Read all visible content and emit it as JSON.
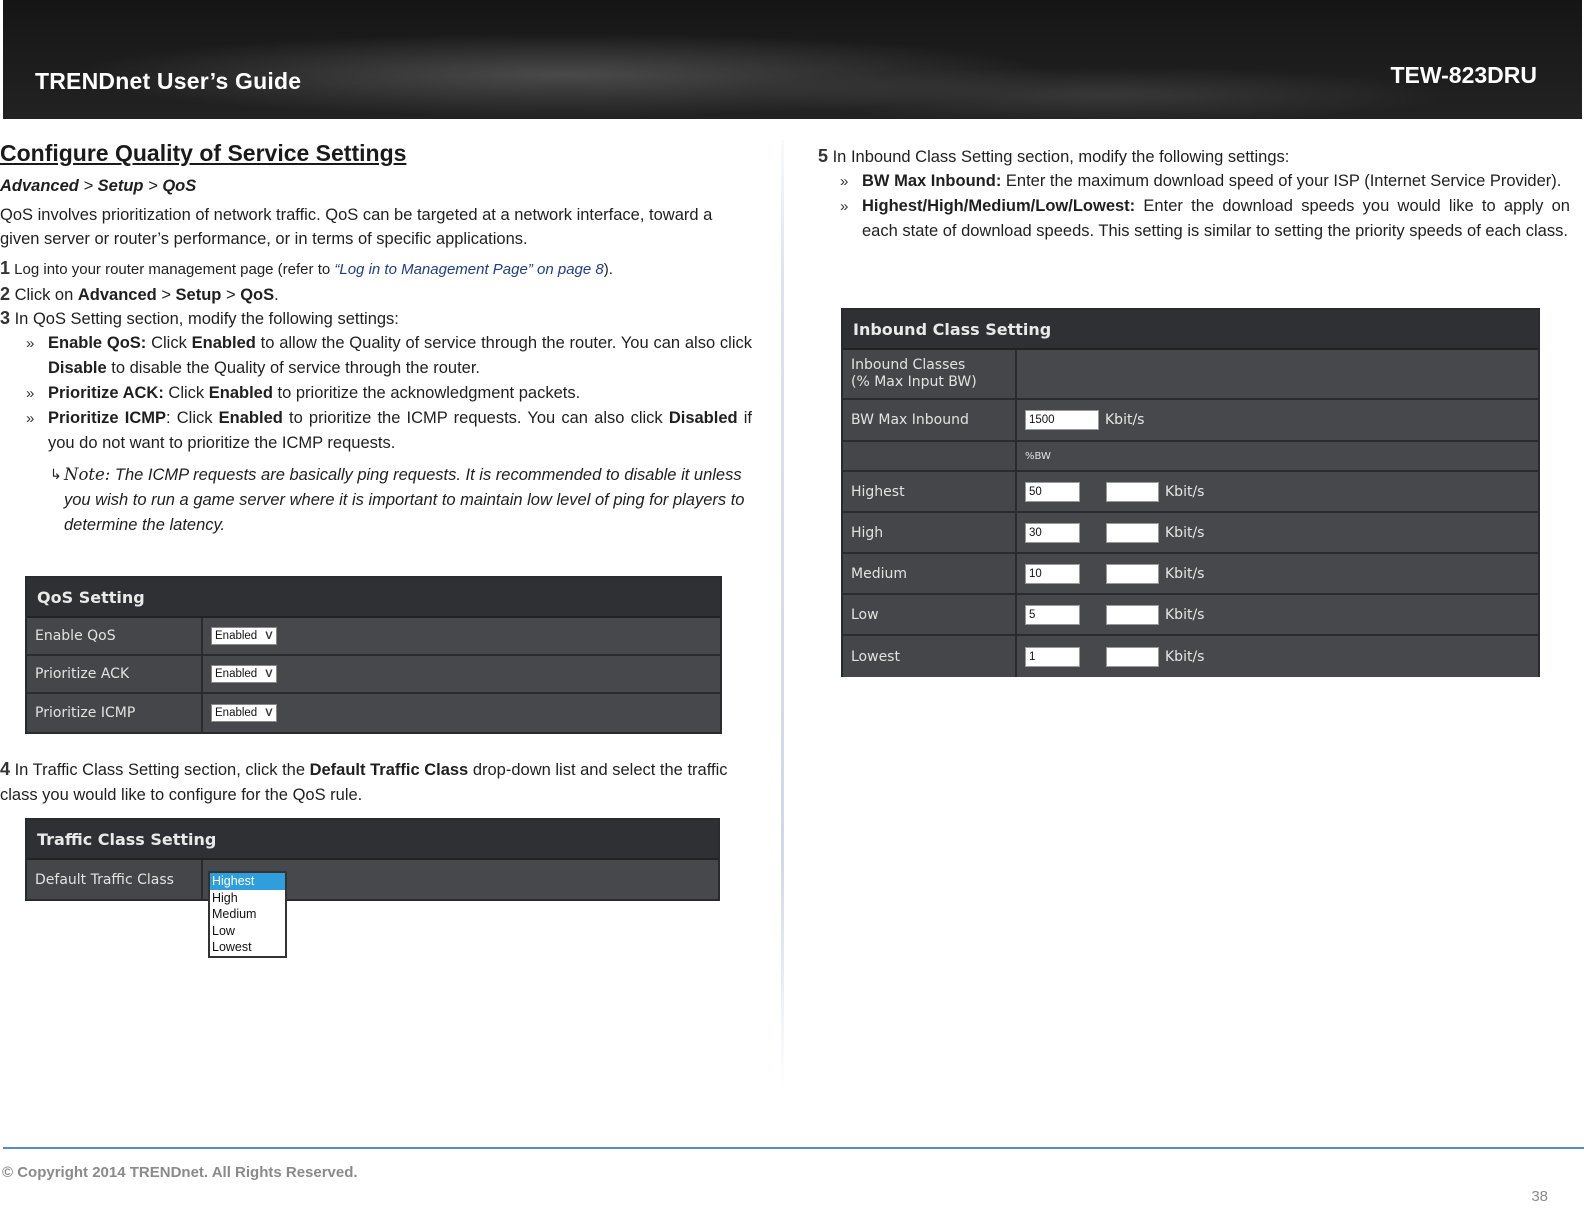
{
  "header": {
    "guide_title": "TRENDnet User’s Guide",
    "model": "TEW-823DRU"
  },
  "left": {
    "title": "Configure Quality of Service Settings",
    "breadcrumb": {
      "part1": "Advanced",
      "sep1": " > ",
      "part2": "Setup",
      "sep2": " > ",
      "part3": "QoS"
    },
    "intro": "QoS involves prioritization of network traffic. QoS can be targeted at a network interface, toward a given server or router’s performance, or in terms of specific applications.",
    "step1": {
      "num": "1",
      "text": " Log into your router management page (refer to ",
      "link": "“Log in to Management Page” on page 8",
      "after": ")."
    },
    "step2": {
      "num": "2",
      "pre": " Click on ",
      "b1": "Advanced",
      "s1": " > ",
      "b2": "Setup",
      "s2": " > ",
      "b3": "QoS",
      "end": "."
    },
    "step3": {
      "num": "3",
      "text": " In QoS Setting section, modify the following settings:"
    },
    "bullets": [
      {
        "chev": "»",
        "bold": "Enable QoS:",
        "t1": " Click ",
        "b2": "Enabled",
        "t2": " to allow the Quality of service through the router. You can also click ",
        "b3": "Disable",
        "t3": " to disable the Quality of service through the router."
      },
      {
        "chev": "»",
        "bold": "Prioritize ACK:",
        "t1": " Click ",
        "b2": "Enabled",
        "t2": " to prioritize the acknowledgment packets."
      },
      {
        "chev": "»",
        "bold": "Prioritize ICMP",
        "t1": ": Click ",
        "b2": "Enabled",
        "t2": " to prioritize the ICMP requests. You can also click ",
        "b3": "Disabled",
        "t3": " if you do not want to prioritize the ICMP requests."
      }
    ],
    "note": {
      "icon": "↳",
      "word": "Note:",
      "text": " The ICMP requests are basically ping requests. It is recommended to disable it unless you wish to run a game server where it is important to maintain low level of ping for players to determine the latency."
    },
    "qos_panel": {
      "title": "QoS Setting",
      "rows": [
        {
          "label": "Enable QoS",
          "value": "Enabled"
        },
        {
          "label": "Prioritize ACK",
          "value": "Enabled"
        },
        {
          "label": "Prioritize ICMP",
          "value": "Enabled"
        }
      ],
      "arrow": "V"
    },
    "step4": {
      "num": "4",
      "pre": " In Traffic Class Setting section, click the ",
      "bold": "Default Traffic Class",
      "post": " drop-down list and select the traffic class you would like to configure for the QoS rule."
    },
    "traffic_panel": {
      "title": "Traffic Class Setting",
      "label": "Default Traffic Class",
      "options": [
        "Highest",
        "High",
        "Medium",
        "Low",
        "Lowest"
      ],
      "selected": "Highest"
    }
  },
  "right": {
    "step5": {
      "num": "5",
      "text": " In Inbound Class Setting section, modify the following settings:"
    },
    "bullets": [
      {
        "chev": "»",
        "bold": "BW Max Inbound:",
        "text": " Enter the maximum download speed of your ISP (Internet Service Provider)."
      },
      {
        "chev": "»",
        "bold": "Highest/High/Medium/Low/Lowest:",
        "text": " Enter the download speeds you would like to apply on each state of download speeds. This setting is similar to setting the priority speeds of each class."
      }
    ],
    "inbound_panel": {
      "title": "Inbound Class Setting",
      "classes_label_1": "Inbound Classes",
      "classes_label_2": "(% Max Input BW)",
      "bw_label": "BW Max Inbound",
      "bw_value": "1500",
      "unit": "Kbit/s",
      "pct_header": "%BW",
      "rows": [
        {
          "label": "Highest",
          "pct": "50",
          "kbit": ""
        },
        {
          "label": "High",
          "pct": "30",
          "kbit": ""
        },
        {
          "label": "Medium",
          "pct": "10",
          "kbit": ""
        },
        {
          "label": "Low",
          "pct": "5",
          "kbit": ""
        },
        {
          "label": "Lowest",
          "pct": "1",
          "kbit": ""
        }
      ]
    }
  },
  "footer": {
    "copyright": "© Copyright 2014 TRENDnet. All Rights Reserved.",
    "page": "38"
  }
}
